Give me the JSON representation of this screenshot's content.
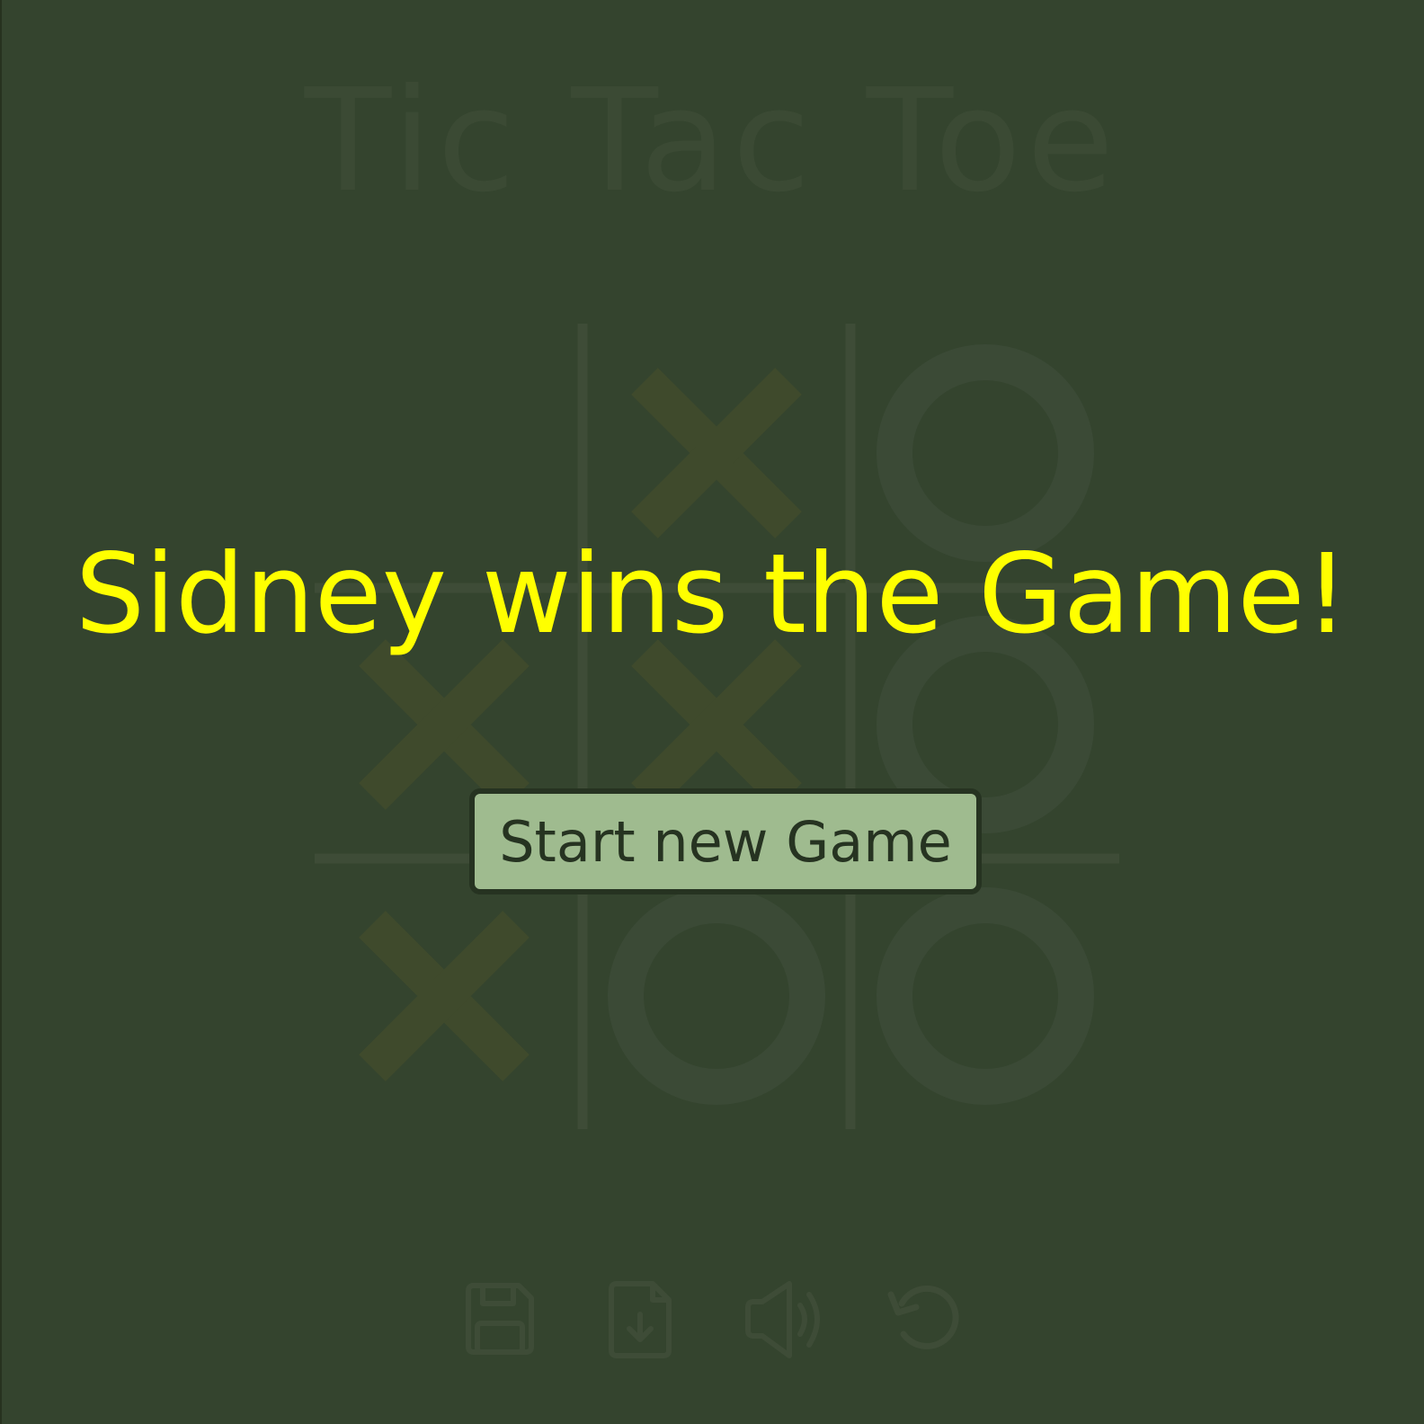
{
  "title": "Tic Tac Toe",
  "board": {
    "cells": [
      "",
      "X",
      "O",
      "X",
      "X",
      "O",
      "X",
      "O",
      "O"
    ],
    "colors": {
      "x": "#3f4a2c",
      "o": "#3b4a36",
      "grid": "#3e4c37"
    }
  },
  "result": {
    "message": "Sidney wins the Game!",
    "color": "#ffff00"
  },
  "new_game_button": {
    "label": "Start new Game"
  },
  "toolbar": {
    "icons": [
      "save-icon",
      "load-file-icon",
      "sound-icon",
      "undo-icon"
    ],
    "color": "#3e4c37"
  }
}
